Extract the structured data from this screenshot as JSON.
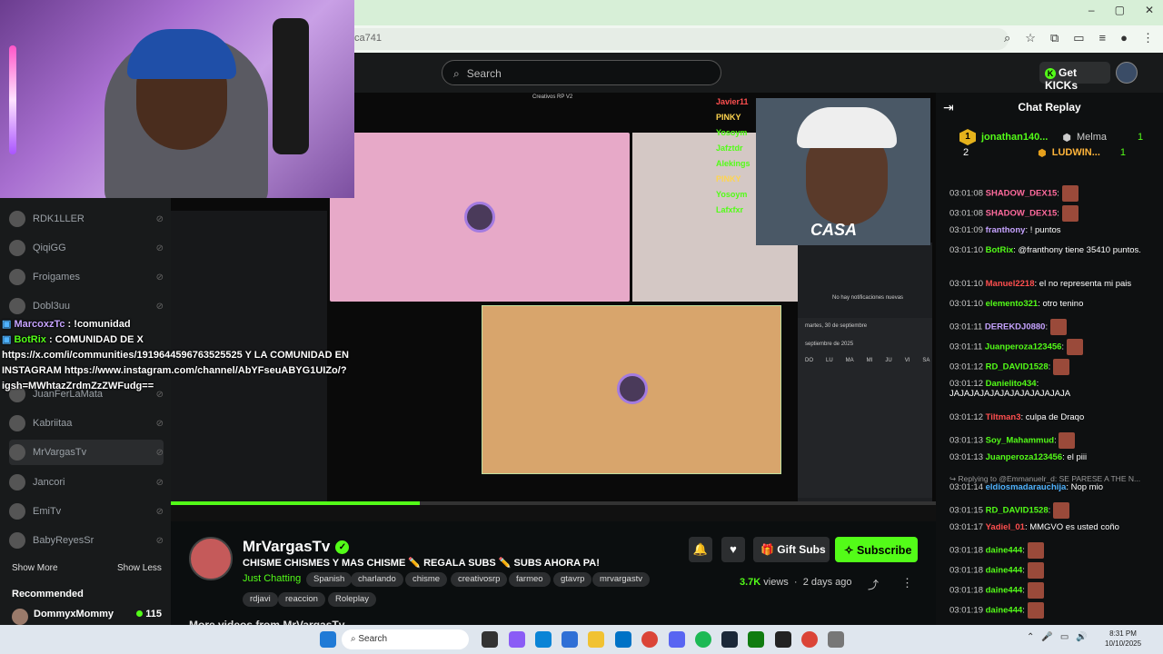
{
  "browser": {
    "url_fragment": "ca741",
    "window_controls": [
      "–",
      "▢",
      "✕"
    ]
  },
  "header": {
    "search_placeholder": "Search",
    "get_kicks": "Get KICKs"
  },
  "overlay_chat": [
    {
      "name": "MarcoxzTc",
      "text": " : !comunidad"
    },
    {
      "name": "BotRix",
      "text": " : COMUNIDAD DE X https://x.com/i/communities/1919644596763525525 Y LA COMUNIDAD EN INSTAGRAM https://www.instagram.com/channel/AbYFseuABYG1UIZo/?igsh=MWhtazZrdmZzZWFudg=="
    }
  ],
  "sidebar": {
    "items": [
      {
        "label": "RDK1LLER"
      },
      {
        "label": "QiqiGG"
      },
      {
        "label": "Froigames"
      },
      {
        "label": "Dobl3uu"
      },
      {
        "label": "JuanFerLaMata"
      },
      {
        "label": "Kabriitaa"
      },
      {
        "label": "MrVargasTv"
      },
      {
        "label": "Jancori"
      },
      {
        "label": "EmiTv"
      },
      {
        "label": "BabyReyesSr"
      }
    ],
    "show_more": "Show More",
    "show_less": "Show Less",
    "recommended": "Recommended",
    "rec_item": {
      "name": "DommyxMommy",
      "count": "115"
    }
  },
  "video": {
    "names": [
      "Javier11",
      "PINKY",
      "Yosoym",
      "Jafztdr",
      "Alekings",
      "PINKY",
      "Yosoym",
      "Lafxfxr"
    ],
    "calendar_date": "martes, 30 de septiembre",
    "calendar_month": "septiembre de 2025",
    "calendar_days": [
      "DO",
      "LU",
      "MA",
      "MI",
      "JU",
      "VI",
      "SA"
    ],
    "banner": "Creativos RP V2",
    "no_notif": "No hay notificaciones nuevas",
    "cam2_text": "CASA",
    "progress_fraction": 0.325
  },
  "channel": {
    "name": "MrVargasTv",
    "title": "CHISME CHISMES Y MAS CHISME ✏️ REGALA SUBS ✏️ SUBS AHORA PA!",
    "category": "Just Chatting",
    "tags": [
      "Spanish",
      "charlando",
      "chisme",
      "creativosrp",
      "farmeo",
      "gtavrp",
      "mrvargastv",
      "rdjavi",
      "reaccion",
      "Roleplay"
    ],
    "gift_subs": "Gift Subs",
    "subscribe": "Subscribe",
    "views_count": "3.7K",
    "views_label": " views",
    "age": "2 days ago",
    "more_videos": "More videos from MrVargasTv"
  },
  "chat": {
    "title": "Chat Replay",
    "leaders": [
      {
        "rank": "1",
        "name": "jonathan140...",
        "count": "2"
      },
      {
        "rank": "2",
        "name": "Melma",
        "count": "1"
      },
      {
        "rank": "3",
        "name": "LUDWIN...",
        "count": "1"
      }
    ],
    "lines": [
      {
        "time": "03:01:08",
        "user": "SHADOW_DEX15",
        "color": "#ff6b9d",
        "text": "",
        "emote": true
      },
      {
        "time": "03:01:08",
        "user": "SHADOW_DEX15",
        "color": "#ff6b9d",
        "text": "",
        "emote": true
      },
      {
        "time": "03:01:09",
        "user": "franthony",
        "color": "#c6a3ff",
        "text": "! puntos",
        "emote": false
      },
      {
        "time": "03:01:10",
        "user": "BotRix",
        "color": "#53fc18",
        "text": "@franthony tiene 35410 puntos.",
        "emote": false
      },
      {
        "time": "03:01:10",
        "user": "Manuel2218",
        "color": "#ff4f4f",
        "text": "el no representa mi pais",
        "emote": false
      },
      {
        "time": "03:01:10",
        "user": "elemento321",
        "color": "#53fc18",
        "text": "otro tenino",
        "emote": false
      },
      {
        "time": "03:01:11",
        "user": "DEREKDJ0880",
        "color": "#c6a3ff",
        "text": "",
        "emote": true
      },
      {
        "time": "03:01:11",
        "user": "Juanperoza123456",
        "color": "#53fc18",
        "text": "",
        "emote": true
      },
      {
        "time": "03:01:12",
        "user": "RD_DAVID1528",
        "color": "#53fc18",
        "text": "",
        "emote": true
      },
      {
        "time": "03:01:12",
        "user": "Danielito434",
        "color": "#53fc18",
        "text": "JAJAJAJAJAJAJAJAJAJAJAJA",
        "emote": false
      },
      {
        "time": "03:01:12",
        "user": "Tiltman3",
        "color": "#ff4f4f",
        "text": "culpa de Draqo",
        "emote": false
      },
      {
        "time": "03:01:13",
        "user": "Soy_Mahammud",
        "color": "#53fc18",
        "text": "",
        "emote": true
      },
      {
        "time": "03:01:13",
        "user": "Juanperoza123456",
        "color": "#53fc18",
        "text": "el piii",
        "emote": false
      },
      {
        "time": "03:01:14",
        "user": "eldiosmadarauchija",
        "color": "#4fb3ff",
        "text": "Nop mio",
        "emote": false
      },
      {
        "time": "03:01:15",
        "user": "RD_DAVID1528",
        "color": "#53fc18",
        "text": "",
        "emote": true
      },
      {
        "time": "03:01:17",
        "user": "Yadiel_01",
        "color": "#ff4f4f",
        "text": "MMGVO es usted coño",
        "emote": false
      },
      {
        "time": "03:01:18",
        "user": "daine444",
        "color": "#53fc18",
        "text": "",
        "emote": true
      },
      {
        "time": "03:01:18",
        "user": "daine444",
        "color": "#53fc18",
        "text": "",
        "emote": true
      },
      {
        "time": "03:01:18",
        "user": "daine444",
        "color": "#53fc18",
        "text": "",
        "emote": true
      },
      {
        "time": "03:01:19",
        "user": "daine444",
        "color": "#53fc18",
        "text": "",
        "emote": true
      }
    ],
    "reply_note": "↪ Replying to @Emmanuelr_d: SE PARESE A THE N..."
  },
  "taskbar": {
    "search": "Search",
    "time": "8:31 PM",
    "date": "10/10/2025"
  }
}
